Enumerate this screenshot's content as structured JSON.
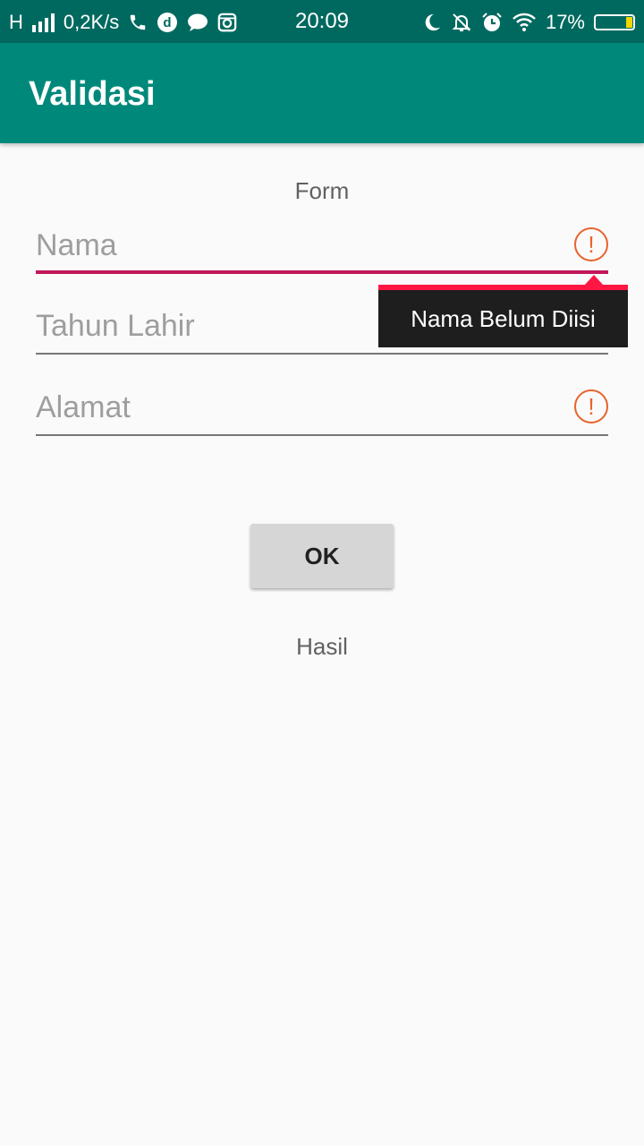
{
  "status_bar": {
    "network": "H",
    "speed": "0,2K/s",
    "time": "20:09",
    "battery": "17%",
    "battery_level_percent": 17,
    "icons_left": [
      "signal-icon",
      "phone-icon",
      "d-app-icon",
      "chat-icon",
      "instagram-icon"
    ],
    "icons_right": [
      "moon-icon",
      "mute-bell-icon",
      "alarm-icon",
      "wifi-icon",
      "battery-icon"
    ]
  },
  "app_bar": {
    "title": "Validasi"
  },
  "form": {
    "label": "Form",
    "fields": [
      {
        "placeholder": "Nama",
        "value": "",
        "focused": true,
        "error_icon": "error-icon"
      },
      {
        "placeholder": "Tahun Lahir",
        "value": "",
        "focused": false,
        "error_icon": "error-icon"
      },
      {
        "placeholder": "Alamat",
        "value": "",
        "focused": false,
        "error_icon": "error-icon"
      }
    ],
    "error_popup": "Nama Belum Diisi",
    "ok_label": "OK",
    "result_label": "Hasil"
  },
  "colors": {
    "status_bar": "#00695f",
    "app_bar": "#00897b",
    "focus_underline": "#c2185b",
    "error_icon": "#e8632b",
    "popup_accent": "#ff1744"
  }
}
